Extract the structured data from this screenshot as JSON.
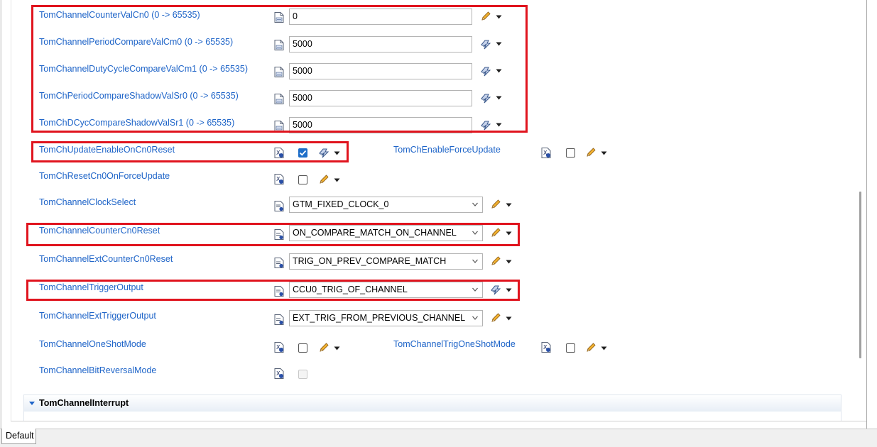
{
  "rows": {
    "counter_val_cn0": {
      "label": "TomChannelCounterValCn0 (0 -> 65535)",
      "value": "0",
      "action": "pencil-icon"
    },
    "period_compare_cm0": {
      "label": "TomChannelPeriodCompareValCm0 (0 -> 65535)",
      "value": "5000",
      "action": "calculated-value-icon"
    },
    "duty_cycle_cm1": {
      "label": "TomChannelDutyCycleCompareValCm1 (0 -> 65535)",
      "value": "5000",
      "action": "calculated-value-icon"
    },
    "period_shadow_sr0": {
      "label": "TomChPeriodCompareShadowValSr0 (0 -> 65535)",
      "value": "5000",
      "action": "calculated-value-icon"
    },
    "dcyc_shadow_sr1": {
      "label": "TomChDCycCompareShadowValSr1 (0 -> 65535)",
      "value": "5000",
      "action": "calculated-value-icon"
    },
    "update_enable_cn0_reset": {
      "label": "TomChUpdateEnableOnCn0Reset",
      "checked": true
    },
    "enable_force_update": {
      "label": "TomChEnableForceUpdate",
      "checked": false
    },
    "reset_cn0_force_update": {
      "label": "TomChResetCn0OnForceUpdate",
      "checked": false
    },
    "clock_select": {
      "label": "TomChannelClockSelect",
      "value": "GTM_FIXED_CLOCK_0"
    },
    "counter_cn0_reset": {
      "label": "TomChannelCounterCn0Reset",
      "value": "ON_COMPARE_MATCH_ON_CHANNEL"
    },
    "ext_counter_cn0_reset": {
      "label": "TomChannelExtCounterCn0Reset",
      "value": "TRIG_ON_PREV_COMPARE_MATCH"
    },
    "trigger_output": {
      "label": "TomChannelTriggerOutput",
      "value": "CCU0_TRIG_OF_CHANNEL"
    },
    "ext_trigger_output": {
      "label": "TomChannelExtTriggerOutput",
      "value": "EXT_TRIG_FROM_PREVIOUS_CHANNEL"
    },
    "one_shot_mode": {
      "label": "TomChannelOneShotMode",
      "checked": false
    },
    "trig_one_shot_mode": {
      "label": "TomChannelTrigOneShotMode",
      "checked": false
    },
    "bit_reversal_mode": {
      "label": "TomChannelBitReversalMode",
      "checked": false,
      "disabled": true
    }
  },
  "section": {
    "title": "TomChannelInterrupt",
    "expanded": true
  },
  "tabs": [
    {
      "label": "Default",
      "active": true
    }
  ],
  "colors": {
    "label": "#1e64c8",
    "highlight_box": "#e0141e",
    "checkbox_checked": "#1e6ec8",
    "pencil": "#e8a020",
    "calc_icon": "#3c5a8c"
  }
}
